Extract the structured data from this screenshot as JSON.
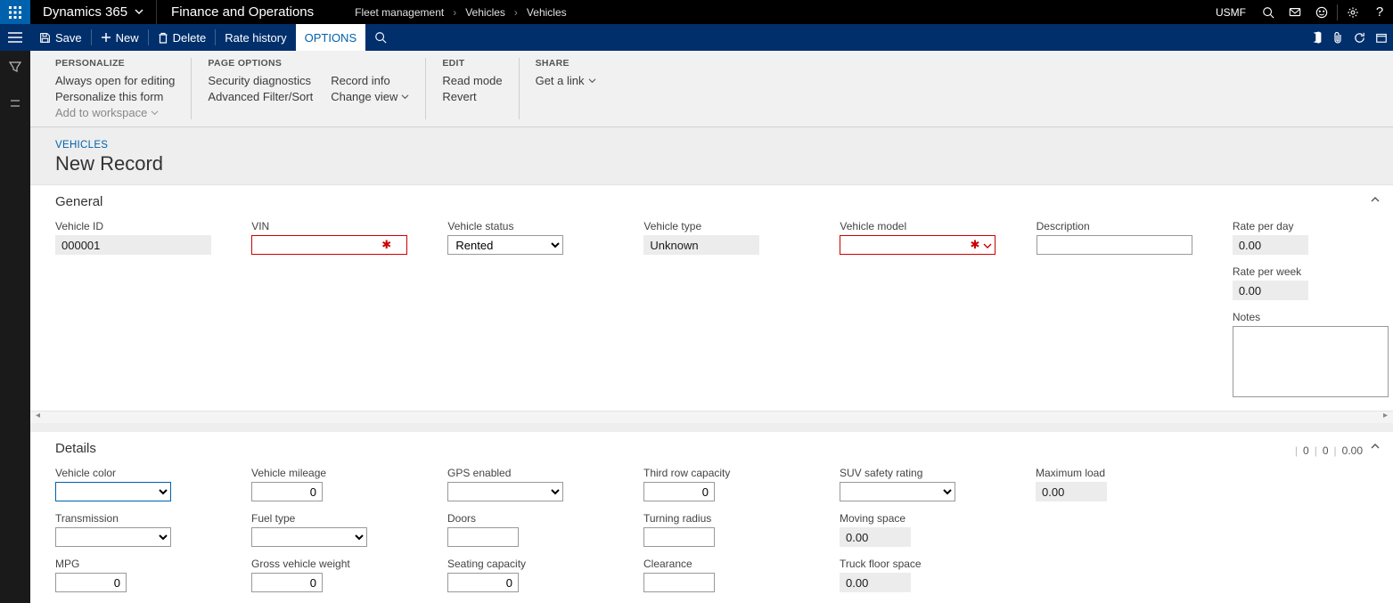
{
  "topbar": {
    "brand": "Dynamics 365",
    "module": "Finance and Operations",
    "breadcrumbs": [
      "Fleet management",
      "Vehicles",
      "Vehicles"
    ],
    "company": "USMF"
  },
  "actions": {
    "save": "Save",
    "new": "New",
    "delete": "Delete",
    "rate_history": "Rate history",
    "options": "OPTIONS"
  },
  "ribbon": {
    "personalize": {
      "title": "PERSONALIZE",
      "always_open": "Always open for editing",
      "personalize_form": "Personalize this form",
      "add_workspace": "Add to workspace"
    },
    "page_options": {
      "title": "PAGE OPTIONS",
      "security": "Security diagnostics",
      "adv_filter": "Advanced Filter/Sort",
      "record_info": "Record info",
      "change_view": "Change view"
    },
    "edit": {
      "title": "EDIT",
      "read_mode": "Read mode",
      "revert": "Revert"
    },
    "share": {
      "title": "SHARE",
      "get_link": "Get a link"
    }
  },
  "pagehead": {
    "crumb": "VEHICLES",
    "title": "New Record"
  },
  "general": {
    "title": "General",
    "vehicle_id": {
      "label": "Vehicle ID",
      "value": "000001"
    },
    "vin": {
      "label": "VIN",
      "value": ""
    },
    "status": {
      "label": "Vehicle status",
      "value": "Rented"
    },
    "vtype": {
      "label": "Vehicle type",
      "value": "Unknown"
    },
    "model": {
      "label": "Vehicle model",
      "value": ""
    },
    "description": {
      "label": "Description",
      "value": ""
    },
    "rate_day": {
      "label": "Rate per day",
      "value": "0.00"
    },
    "rate_week": {
      "label": "Rate per week",
      "value": "0.00"
    },
    "notes": {
      "label": "Notes",
      "value": ""
    }
  },
  "details": {
    "title": "Details",
    "summary": [
      "0",
      "0",
      "0.00"
    ],
    "color": {
      "label": "Vehicle color"
    },
    "transmission": {
      "label": "Transmission"
    },
    "mpg": {
      "label": "MPG",
      "value": "0"
    },
    "mileage": {
      "label": "Vehicle mileage",
      "value": "0"
    },
    "fuel": {
      "label": "Fuel type"
    },
    "gvw": {
      "label": "Gross vehicle weight",
      "value": "0"
    },
    "gps": {
      "label": "GPS enabled"
    },
    "doors": {
      "label": "Doors",
      "value": ""
    },
    "seating": {
      "label": "Seating capacity",
      "value": "0"
    },
    "third_row": {
      "label": "Third row capacity",
      "value": "0"
    },
    "turning": {
      "label": "Turning radius",
      "value": ""
    },
    "clearance": {
      "label": "Clearance",
      "value": ""
    },
    "suv": {
      "label": "SUV safety rating"
    },
    "moving": {
      "label": "Moving space",
      "value": "0.00"
    },
    "truck_floor": {
      "label": "Truck floor space",
      "value": "0.00"
    },
    "max_load": {
      "label": "Maximum load",
      "value": "0.00"
    }
  }
}
